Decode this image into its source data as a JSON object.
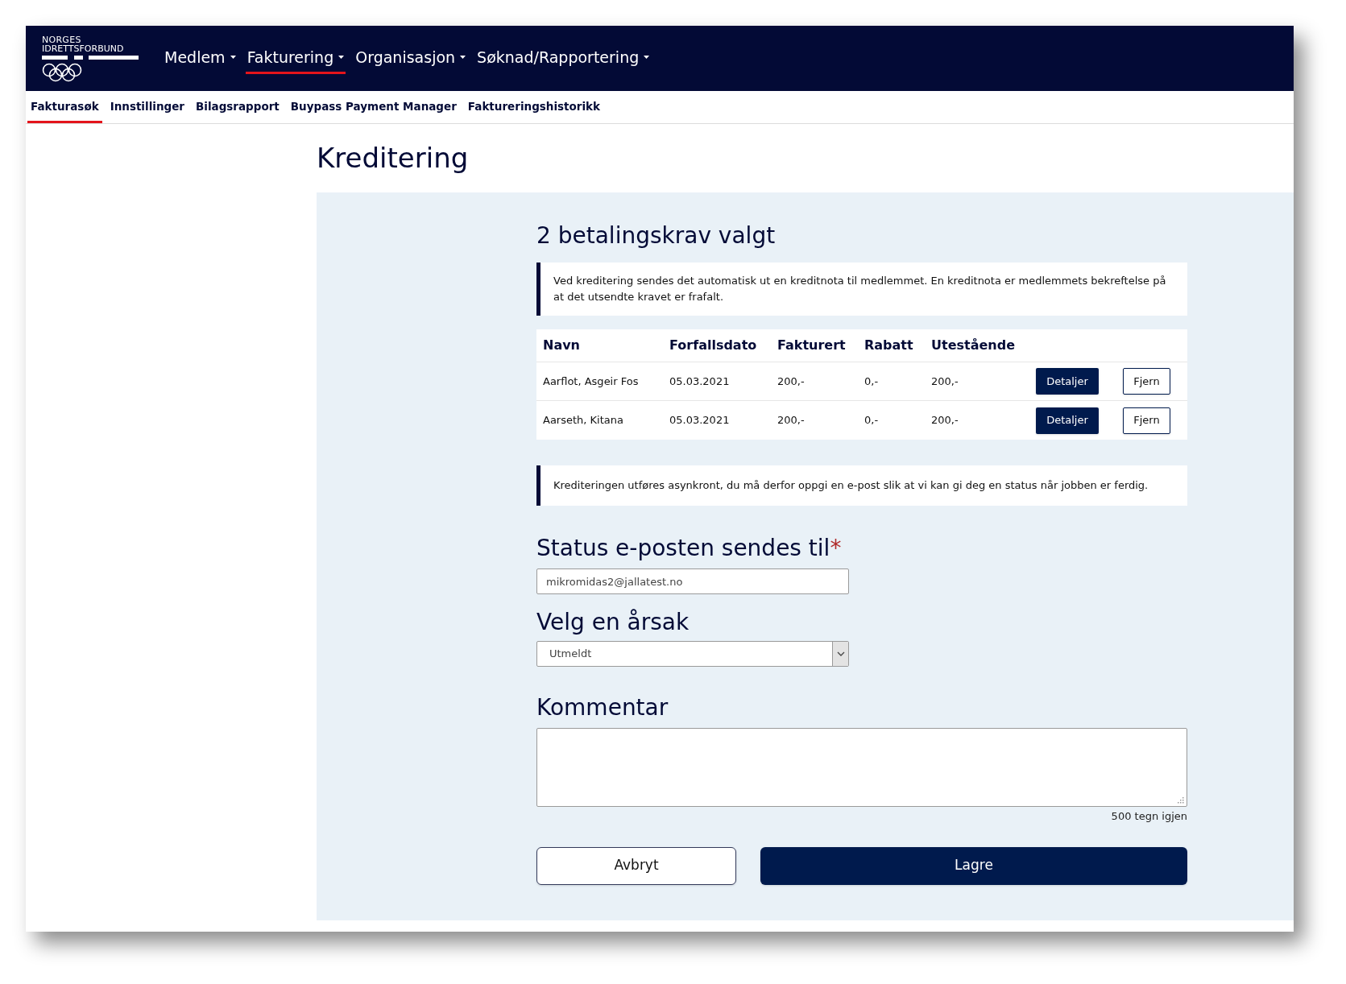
{
  "logo": {
    "line_1": "NORGES",
    "line_2": "IDRETTSFORBUND"
  },
  "main_nav": [
    {
      "label": "Medlem",
      "selected": false
    },
    {
      "label": "Fakturering",
      "selected": true
    },
    {
      "label": "Organisasjon",
      "selected": false
    },
    {
      "label": "Søknad/Rapportering",
      "selected": false
    }
  ],
  "sub_nav": [
    {
      "label": "Fakturasøk",
      "selected": true
    },
    {
      "label": "Innstillinger",
      "selected": false
    },
    {
      "label": "Bilagsrapport",
      "selected": false
    },
    {
      "label": "Buypass Payment Manager",
      "selected": false
    },
    {
      "label": "Faktureringshistorikk",
      "selected": false
    }
  ],
  "page_title": "Kreditering",
  "selection_heading": "2 betalingskrav valgt",
  "info_note": "Ved kreditering sendes det automatisk ut en kreditnota til medlemmet. En kreditnota er medlemmets bekreftelse på at det utsendte kravet er frafalt.",
  "table": {
    "columns": [
      "Navn",
      "Forfallsdato",
      "Fakturert",
      "Rabatt",
      "Utestående"
    ],
    "rows": [
      {
        "cells": [
          "Aarflot, Asgeir Fos",
          "05.03.2021",
          "200,-",
          "0,-",
          "200,-"
        ],
        "details_button": "Detaljer",
        "remove_button": "Fjern"
      },
      {
        "cells": [
          "Aarseth, Kitana",
          "05.03.2021",
          "200,-",
          "0,-",
          "200,-"
        ],
        "details_button": "Detaljer",
        "remove_button": "Fjern"
      }
    ]
  },
  "async_note": "Krediteringen utføres asynkront, du må derfor oppgi en e-post slik at vi kan gi deg en status når jobben er ferdig.",
  "email": {
    "label": "Status e-posten sendes til",
    "required_mark": "*",
    "value": "mikromidas2@jallatest.no"
  },
  "reason": {
    "label": "Velg en årsak",
    "value": "Utmeldt"
  },
  "comment": {
    "label": "Kommentar",
    "counter": "500 tegn igjen"
  },
  "buttons": [
    {
      "label": "Avbryt",
      "kind": "secondary"
    },
    {
      "label": "Lagre",
      "kind": "primary"
    }
  ]
}
